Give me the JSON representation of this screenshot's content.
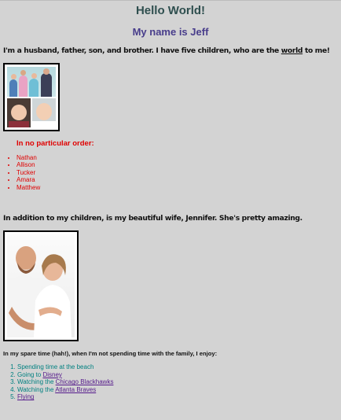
{
  "header": {
    "title": "Hello World!",
    "subtitle": "My name is Jeff"
  },
  "intro": {
    "text_before": "I'm a husband, father, son, and brother. I have five children, who are the ",
    "link": "world",
    "text_after": " to me!"
  },
  "kids_section": {
    "heading": "In no particular order:",
    "children": [
      "Nathan",
      "Allison",
      "Tucker",
      "Amara",
      "Matthew"
    ]
  },
  "wife_text": "In addition to my children, is my beautiful wife, Jennifer. She's pretty amazing.",
  "spare_time": {
    "intro": "In my spare time (hah!), when I'm not spending time with the family, I enjoy:",
    "items": [
      {
        "prefix": "Spending time at the beach",
        "link": ""
      },
      {
        "prefix": "Going to ",
        "link": "Disney"
      },
      {
        "prefix": "Watching the ",
        "link": "Chicago Blackhawks"
      },
      {
        "prefix": "Watching the ",
        "link": "Atlanta Braves"
      },
      {
        "prefix": "",
        "link": "Flying"
      }
    ]
  },
  "colors": {
    "background": "#d3d3d3",
    "title": "#2f4f4f",
    "subtitle": "#483d8b",
    "list_red": "#e00000",
    "hobby_teal": "#008080",
    "link_visited": "#551a8b"
  }
}
